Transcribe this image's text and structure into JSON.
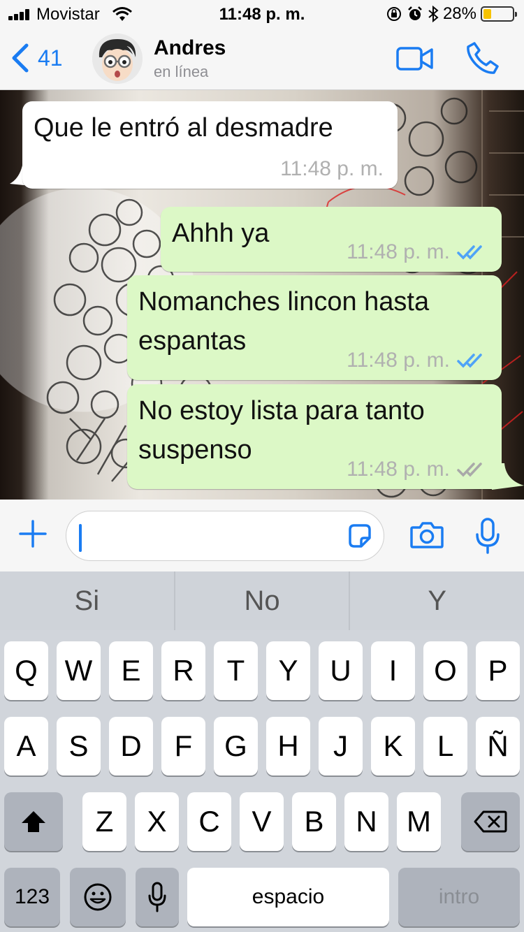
{
  "status_bar": {
    "carrier": "Movistar",
    "time": "11:48 p. m.",
    "battery_percent": "28%",
    "battery_level": 0.28
  },
  "header": {
    "back_count": "41",
    "contact_name": "Andres",
    "contact_status": "en línea",
    "icons": [
      "chevron-left-icon",
      "avatar",
      "video-call-icon",
      "phone-icon"
    ],
    "accent_color": "#1a7cf2"
  },
  "messages": [
    {
      "direction": "in",
      "text": "Que le entró al desmadre",
      "time": "11:48 p. m."
    },
    {
      "direction": "out",
      "text": "Ahhh ya",
      "time": "11:48 p. m.",
      "ticks": "read"
    },
    {
      "direction": "out",
      "text": "Nomanches lincon hasta\nespantas",
      "time": "11:48 p. m.",
      "ticks": "read"
    },
    {
      "direction": "out",
      "text": "No estoy lista para tanto\nsuspenso",
      "time": "11:48 p. m.",
      "ticks": "delivered"
    }
  ],
  "colors": {
    "incoming_bubble": "#ffffff",
    "outgoing_bubble": "#dcf8c6",
    "read_ticks": "#4fa3f7",
    "delivered_ticks": "#a9a9a9"
  },
  "input": {
    "value": "",
    "icons": [
      "plus-icon",
      "sticker-icon",
      "camera-icon",
      "microphone-icon"
    ]
  },
  "suggestions": [
    "Si",
    "No",
    "Y"
  ],
  "keyboard": {
    "row1": [
      "Q",
      "W",
      "E",
      "R",
      "T",
      "Y",
      "U",
      "I",
      "O",
      "P"
    ],
    "row2": [
      "A",
      "S",
      "D",
      "F",
      "G",
      "H",
      "J",
      "K",
      "L",
      "Ñ"
    ],
    "row3": [
      "Z",
      "X",
      "C",
      "V",
      "B",
      "N",
      "M"
    ],
    "numbers_label": "123",
    "space_label": "espacio",
    "return_label": "intro"
  }
}
